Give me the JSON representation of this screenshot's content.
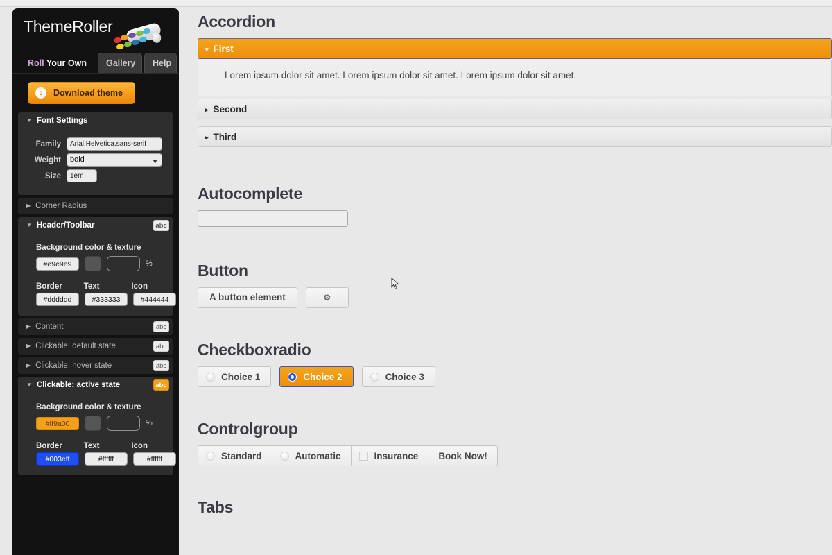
{
  "sidebar": {
    "logo_text": "ThemeRoller",
    "logo_icon": "paint-roller-icon",
    "tabs": [
      {
        "label_a": "Roll",
        "label_b": " Your Own",
        "active": true
      },
      {
        "label": "Gallery",
        "active": false
      },
      {
        "label": "Help",
        "active": false
      }
    ],
    "download": {
      "label": "Download theme",
      "icon": "download-arrow-icon",
      "glyph": "↓"
    },
    "groups": [
      {
        "title": "Font Settings",
        "open": true,
        "fields": [
          {
            "label": "Family",
            "value": "Arial,Helvetica,sans-serif",
            "type": "text"
          },
          {
            "label": "Weight",
            "value": "bold",
            "type": "select"
          },
          {
            "label": "Size",
            "value": "1em",
            "type": "text"
          }
        ]
      },
      {
        "title": "Corner Radius",
        "open": false,
        "badge": null
      },
      {
        "title": "Header/Toolbar",
        "open": true,
        "badge": "abc",
        "bg_label": "Background color & texture",
        "bg_hex": "#e9e9e9",
        "pct_symbol": "%",
        "sub_labels": [
          "Border",
          "Text",
          "Icon"
        ],
        "sub_values": [
          "#dddddd",
          "#333333",
          "#444444"
        ]
      },
      {
        "title": "Content",
        "open": false,
        "badge": "abc"
      },
      {
        "title": "Clickable: default state",
        "open": false,
        "badge": "abc"
      },
      {
        "title": "Clickable: hover state",
        "open": false,
        "badge": "abc"
      },
      {
        "title": "Clickable: active state",
        "open": true,
        "badge": "abc",
        "bg_label": "Background color & texture",
        "bg_hex": "#ff9a00",
        "pct_symbol": "%",
        "sub_labels": [
          "Border",
          "Text",
          "Icon"
        ],
        "sub_values": [
          "#003eff",
          "#ffffff",
          "#ffffff"
        ]
      }
    ]
  },
  "main": {
    "accordion": {
      "heading": "Accordion",
      "items": [
        {
          "label": "First",
          "active": true,
          "arrow": "▾"
        },
        {
          "label": "Second",
          "active": false,
          "arrow": "▸"
        },
        {
          "label": "Third",
          "active": false,
          "arrow": "▸"
        }
      ],
      "panel_text": "Lorem ipsum dolor sit amet. Lorem ipsum dolor sit amet. Lorem ipsum dolor sit amet."
    },
    "autocomplete": {
      "heading": "Autocomplete",
      "value": "",
      "placeholder": ""
    },
    "button": {
      "heading": "Button",
      "labels": [
        "A button element"
      ],
      "icon_button": {
        "icon": "gear-icon",
        "glyph": "⚙"
      }
    },
    "checkboxradio": {
      "heading": "Checkboxradio",
      "options": [
        {
          "label": "Choice 1",
          "checked": false
        },
        {
          "label": "Choice 2",
          "checked": true
        },
        {
          "label": "Choice 3",
          "checked": false
        }
      ]
    },
    "controlgroup": {
      "heading": "Controlgroup",
      "items": [
        {
          "label": "Standard",
          "control": "radio"
        },
        {
          "label": "Automatic",
          "control": "radio"
        },
        {
          "label": "Insurance",
          "control": "checkbox"
        },
        {
          "label": "Book Now!",
          "control": "button"
        }
      ]
    },
    "tabs": {
      "heading": "Tabs"
    }
  },
  "colors": {
    "accent_orange": "#f5a01b",
    "active_border_blue": "#003eff",
    "page_bg": "#e8e8e8",
    "sidebar_bg": "#121212"
  }
}
